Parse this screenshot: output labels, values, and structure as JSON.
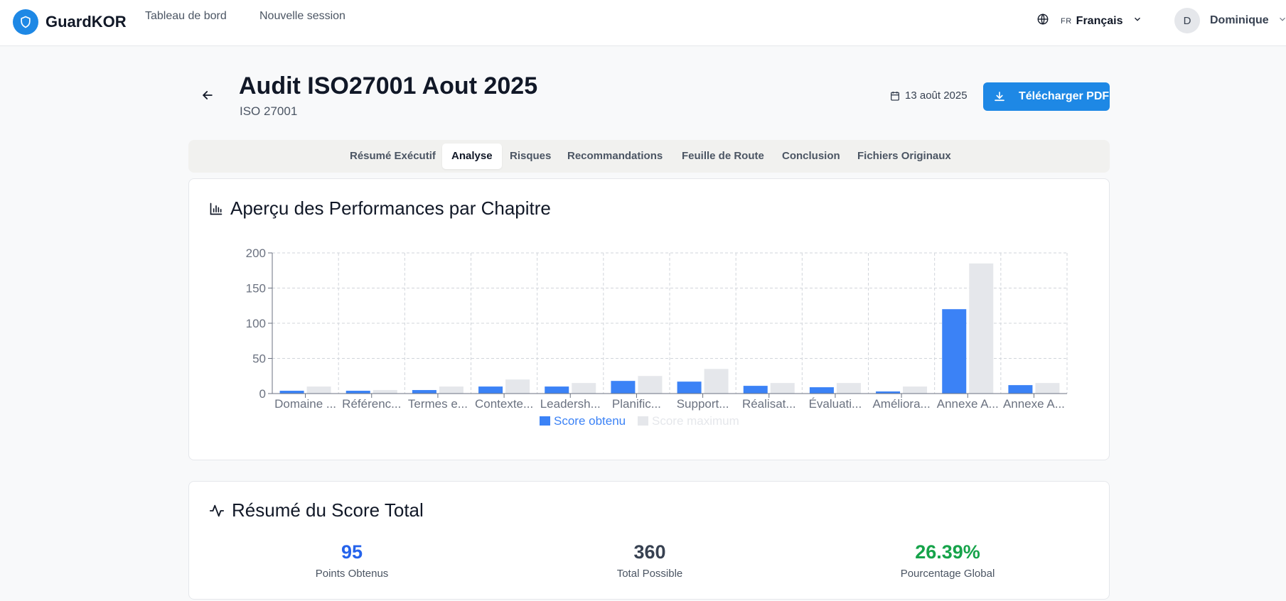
{
  "app": {
    "name": "GuardKOR"
  },
  "nav": {
    "dashboard": "Tableau de bord",
    "new_session": "Nouvelle session"
  },
  "language": {
    "code": "FR",
    "name": "Français"
  },
  "user": {
    "initial": "D",
    "name": "Dominique"
  },
  "header": {
    "title": "Audit ISO27001 Aout 2025",
    "subtitle": "ISO 27001",
    "date": "13 août 2025",
    "download_label": "Télécharger PDF"
  },
  "tabs": [
    {
      "label": "Résumé Exécutif",
      "active": false
    },
    {
      "label": "Analyse",
      "active": true
    },
    {
      "label": "Risques",
      "active": false
    },
    {
      "label": "Recommandations",
      "active": false
    },
    {
      "label": "Feuille de Route",
      "active": false
    },
    {
      "label": "Conclusion",
      "active": false
    },
    {
      "label": "Fichiers Originaux",
      "active": false
    }
  ],
  "performance_card": {
    "title": "Aperçu des Performances par Chapitre"
  },
  "chart_data": {
    "type": "bar",
    "categories": [
      "Domaine ...",
      "Référenc...",
      "Termes e...",
      "Contexte...",
      "Leadersh...",
      "Planific...",
      "Support...",
      "Réalisat...",
      "Évaluati...",
      "Améliora...",
      "Annexe A...",
      "Annexe A..."
    ],
    "series": [
      {
        "name": "Score obtenu",
        "color": "#3b82f6",
        "values": [
          4,
          4,
          5,
          10,
          10,
          18,
          17,
          11,
          9,
          3,
          120,
          12
        ]
      },
      {
        "name": "Score maximum",
        "color": "#e5e7eb",
        "values": [
          10,
          5,
          10,
          20,
          15,
          25,
          35,
          15,
          15,
          10,
          185,
          15
        ]
      }
    ],
    "y_ticks": [
      0,
      50,
      100,
      150,
      200
    ],
    "ylim": [
      0,
      200
    ],
    "grid": true,
    "legend": "bottom"
  },
  "score_card": {
    "title": "Résumé du Score Total",
    "stats": [
      {
        "value": "95",
        "label": "Points Obtenus",
        "color": "#2563eb"
      },
      {
        "value": "360",
        "label": "Total Possible",
        "color": "#374151"
      },
      {
        "value": "26.39%",
        "label": "Pourcentage Global",
        "color": "#16a34a"
      }
    ]
  }
}
